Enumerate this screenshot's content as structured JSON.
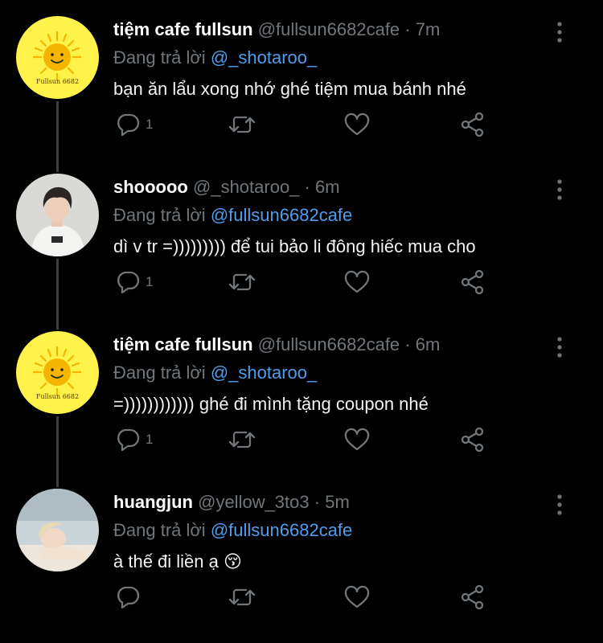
{
  "replying_prefix": "Đang trả lời",
  "tweets": [
    {
      "name": "tiệm cafe fullsun",
      "handle": "@fullsun6682cafe",
      "separator": "·",
      "time": "7m",
      "replying_to": "@_shotaroo_",
      "text": "bạn ăn lẩu xong nhớ ghé tiệm mua bánh nhé",
      "reply_count": "1",
      "avatar_icon": "sun-logo-avatar",
      "avatar_text": "Fullsun 6682"
    },
    {
      "name": "shooooo",
      "handle": "@_shotaroo_",
      "separator": "·",
      "time": "6m",
      "replying_to": "@fullsun6682cafe",
      "text": "dì v tr =))))))))) để tui bảo li đông hiếc mua cho",
      "reply_count": "1",
      "avatar_icon": "person-photo-avatar"
    },
    {
      "name": "tiệm cafe fullsun",
      "handle": "@fullsun6682cafe",
      "separator": "·",
      "time": "6m",
      "replying_to": "@_shotaroo_",
      "text": "=)))))))))))) ghé đi mình tặng coupon nhé",
      "reply_count": "1",
      "avatar_icon": "sun-logo-avatar",
      "avatar_text": "Fullsun 6682"
    },
    {
      "name": "huangjun",
      "handle": "@yellow_3to3",
      "separator": "·",
      "time": "5m",
      "replying_to": "@fullsun6682cafe",
      "text": "à thế đi liền ạ 😚",
      "reply_count": "",
      "avatar_icon": "person-photo-avatar"
    }
  ],
  "colors": {
    "background": "#000000",
    "muted": "#71767b",
    "mention": "#4f9ef0",
    "sun_avatar_bg": "#fff24a",
    "sun_rays": "#f5b400",
    "thread_line": "#3a3f44"
  }
}
